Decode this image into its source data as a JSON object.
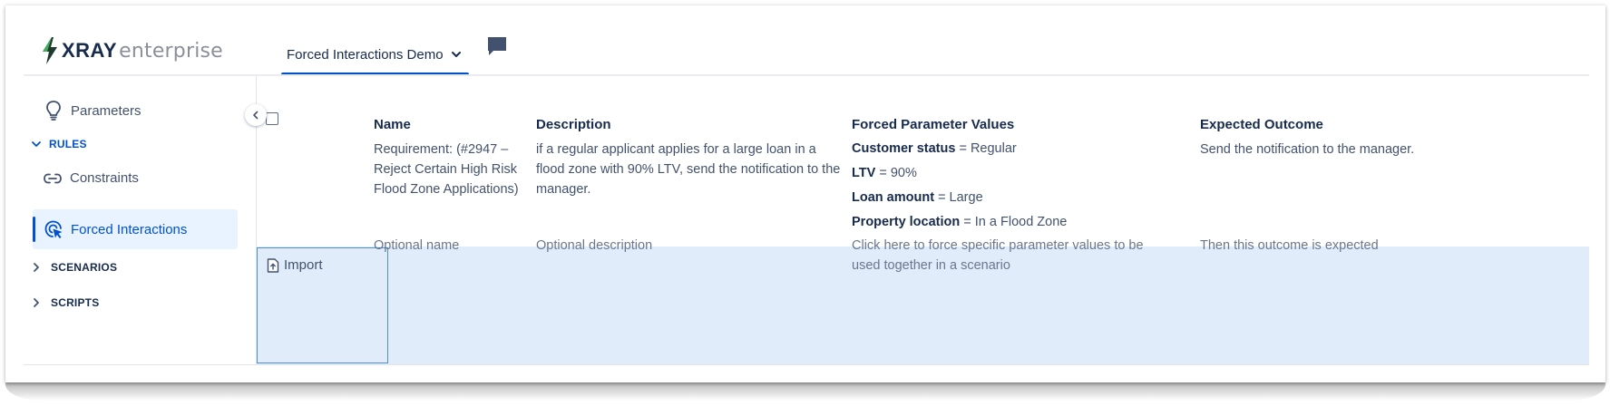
{
  "brand": {
    "name_bold": "XRAY",
    "name_light": "enterprise"
  },
  "header": {
    "project_tab": "Forced Interactions Demo"
  },
  "sidebar": {
    "parameters": "Parameters",
    "rules_section": "RULES",
    "constraints": "Constraints",
    "forced_interactions": "Forced Interactions",
    "scenarios_section": "SCENARIOS",
    "scripts_section": "SCRIPTS"
  },
  "table": {
    "columns": [
      "Name",
      "Description",
      "Forced Parameter Values",
      "Expected Outcome"
    ],
    "rows": [
      {
        "name": "Requirement: (#2947 – Reject Certain High Risk Flood Zone Applications)",
        "description": "if a regular applicant applies for a large loan in a flood zone with 90% LTV, send the notification to the manager.",
        "params": [
          {
            "key": "Customer status",
            "value": "= Regular"
          },
          {
            "key": "LTV",
            "value": "= 90%"
          },
          {
            "key": "Loan amount",
            "value": "= Large"
          },
          {
            "key": "Property location",
            "value": "= In a Flood Zone"
          }
        ],
        "outcome": "Send the notification to the manager."
      }
    ],
    "new_row": {
      "import_label": "Import",
      "name_placeholder": "Optional name",
      "description_placeholder": "Optional description",
      "params_placeholder": "Click here to force specific parameter values to be used together in a scenario",
      "outcome_placeholder": "Then this outcome is expected"
    }
  },
  "colors": {
    "accent": "#0052cc",
    "active_bg": "#e9f2ff",
    "new_row_bg": "#e1ecfa",
    "text": "#42526e",
    "heading": "#172b4d"
  },
  "icons": [
    "bolt-icon",
    "chevron-down-icon",
    "comment-icon",
    "lightbulb-icon",
    "chevron-left-icon",
    "link-icon",
    "cursor-target-icon",
    "chevron-right-icon",
    "import-file-icon"
  ]
}
